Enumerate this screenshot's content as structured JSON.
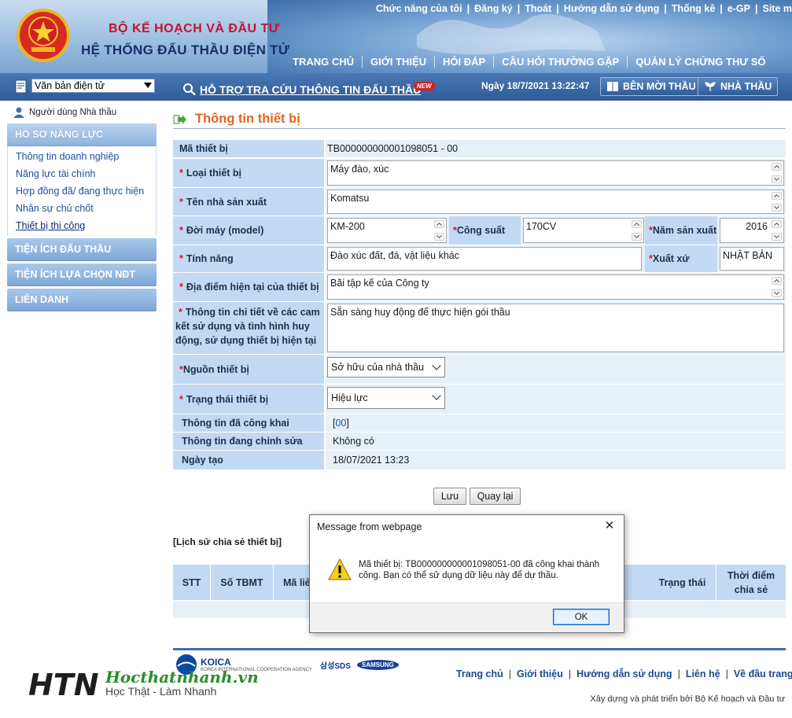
{
  "header": {
    "org_name": "BỘ KẾ HOẠCH VÀ ĐẦU TƯ",
    "system_name": "HỆ THỐNG ĐẤU THẦU ĐIỆN TỬ",
    "top_links": [
      "Chức năng của tôi",
      "Đăng ký",
      "Thoát",
      "Hướng dẫn sử dụng",
      "Thống kê",
      "e-GP",
      "Site m"
    ],
    "main_nav": [
      "TRANG CHỦ",
      "GIỚI THIỆU",
      "HỎI ĐÁP",
      "CÂU HỎI THƯỜNG GẶP",
      "QUẢN LÝ CHỨNG THƯ SỐ"
    ],
    "doc_select_value": "Văn bản điện tử",
    "lookup_link": "HỖ TRỢ TRA CỨU THÔNG TIN ĐẤU THẦU",
    "new_badge": "NEW",
    "datetime": "Ngày 18/7/2021 13:22:47",
    "buttons": {
      "ben_moi_thau": "BÊN MỜI THẦU",
      "nha_thau": "NHÀ THẦU"
    }
  },
  "sidebar": {
    "user_label": "Người dùng Nhà thầu",
    "section_title": "HỒ SƠ NĂNG LỰC",
    "links": [
      "Thông tin doanh nghiệp",
      "Năng lực tài chính",
      "Hợp đồng đã/ đang thực hiện",
      "Nhân sự chủ chốt",
      "Thiết bị thi công"
    ],
    "categories": [
      "TIỆN ÍCH ĐẤU THẦU",
      "TIỆN ÍCH LỰA CHỌN NĐT",
      "LIÊN DANH"
    ]
  },
  "page_title": "Thông tin thiết bị",
  "form": {
    "ma_thiet_bi": {
      "label": "Mã thiết bị",
      "value": "TB000000000001098051 - 00"
    },
    "loai_thiet_bi": {
      "label": "Loại thiết bị",
      "value": "Máy đào, xúc"
    },
    "ten_nha_san_xuat": {
      "label": "Tên nhà sản xuất",
      "value": "Komatsu"
    },
    "doi_may": {
      "label": "Đời máy (model)",
      "value": "KM-200"
    },
    "cong_suat": {
      "label": "Công suất",
      "value": "170CV"
    },
    "nam_san_xuat": {
      "label": "Năm sản xuất",
      "value": "2016"
    },
    "tinh_nang": {
      "label": "Tính năng",
      "value": "Đào xúc đất, đá, vật liệu khác"
    },
    "xuat_xu": {
      "label": "Xuất xứ",
      "value": "NHẬT BẢN"
    },
    "dia_diem": {
      "label": "Địa điểm hiện tại của thiết bị",
      "value": "Bãi tập kế của Công ty"
    },
    "thong_tin_chi_tiet": {
      "label": "Thông tin chi tiết về các cam kết sử dụng và tình hình huy động, sử dụng thiết bị hiện tại",
      "value": "Sẵn sàng huy động để thực hiện gói thầu"
    },
    "nguon_thiet_bi": {
      "label": "Nguồn thiết bị",
      "value": "Sở hữu của nhà thầu"
    },
    "trang_thai": {
      "label": "Trạng thái thiết bị",
      "value": "Hiệu lực"
    },
    "da_cong_khai": {
      "label": "Thông tin đã công khai",
      "bracket_open": "[",
      "link": "00",
      "bracket_close": "]"
    },
    "dang_chinh_sua": {
      "label": "Thông tin đang chỉnh sửa",
      "value": "Không có"
    },
    "ngay_tao": {
      "label": "Ngày tạo",
      "value": "18/07/2021 13:23"
    },
    "required_mark": "*"
  },
  "buttons": {
    "save": "Lưu",
    "back": "Quay lại"
  },
  "history": {
    "title": "[Lịch sử chia sẻ thiết bị]",
    "columns": [
      "STT",
      "Số TBMT",
      "Mã liê",
      "Trạng thái",
      "Thời điểm chia sẻ"
    ]
  },
  "footer": {
    "links": [
      "Trang chủ",
      "Giới thiệu",
      "Hướng dẫn sử dụng",
      "Liên hệ",
      "Về đầu trang"
    ],
    "credit": "Xây dựng và phát triển bởi Bộ Kế hoạch và Đầu tư",
    "logos": {
      "koica": "KOICA",
      "koica_sub": "KOREA INTERNATIONAL COOPERATION AGENCY",
      "sds": "삼성SDS",
      "samsung": "SAMSUNG"
    }
  },
  "watermark": {
    "brand": "Hocthatnhanh.vn",
    "tagline": "Học Thật - Làm Nhanh",
    "logo_text": "HTN"
  },
  "dialog": {
    "title": "Message from webpage",
    "message": "Mã thiết bị: TB000000000001098051-00 đã công khai thành công. Bạn có thể sử dụng dữ liệu này để dự thầu.",
    "ok": "OK",
    "close": "✕"
  },
  "colors": {
    "label_bg": "#c3d9f3",
    "value_bg": "#e6f0f8",
    "title_orange": "#e06422",
    "required_red": "#d0191a",
    "header_blue": "#2e5b97"
  }
}
